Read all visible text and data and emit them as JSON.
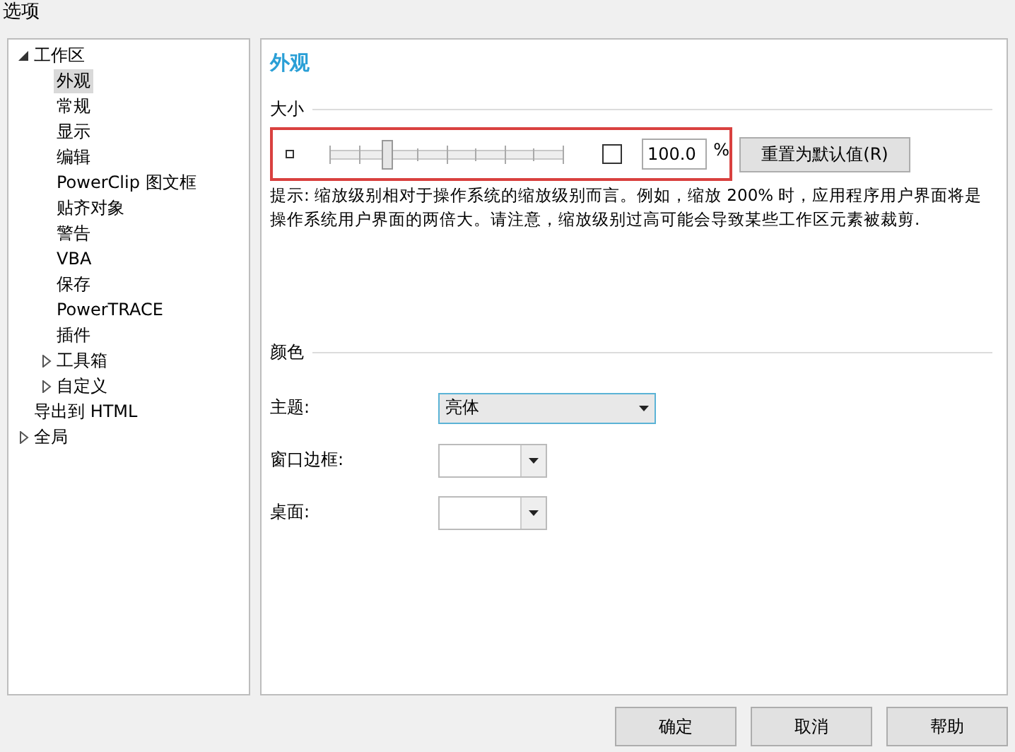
{
  "window": {
    "title": "选项"
  },
  "tree": [
    {
      "label": "工作区",
      "expanded": true,
      "selected": false,
      "children": [
        {
          "label": "外观",
          "selected": true
        },
        {
          "label": "常规",
          "selected": false
        },
        {
          "label": "显示",
          "selected": false
        },
        {
          "label": "编辑",
          "selected": false
        },
        {
          "label": "PowerClip 图文框",
          "selected": false
        },
        {
          "label": "贴齐对象",
          "selected": false
        },
        {
          "label": "警告",
          "selected": false
        },
        {
          "label": "VBA",
          "selected": false
        },
        {
          "label": "保存",
          "selected": false
        },
        {
          "label": "PowerTRACE",
          "selected": false
        },
        {
          "label": "插件",
          "selected": false
        },
        {
          "label": "工具箱",
          "expanded": false,
          "selected": false
        },
        {
          "label": "自定义",
          "expanded": false,
          "selected": false
        }
      ]
    },
    {
      "label": "导出到 HTML",
      "selected": false
    },
    {
      "label": "全局",
      "expanded": false,
      "selected": false
    }
  ],
  "page": {
    "title": "外观",
    "size_section": {
      "heading": "大小",
      "slider": {
        "level": 0.24
      },
      "checkbox": {
        "checked": false
      },
      "zoom_field": {
        "value": "100.0",
        "unit": "%"
      },
      "reset_button": "重置为默认值(R)",
      "hint": "提示: 缩放级别相对于操作系统的缩放级别而言。例如，缩放 200% 时，应用程序用户界面将是操作系统用户界面的两倍大。请注意，缩放级别过高可能会导致某些工作区元素被裁剪."
    },
    "color_section": {
      "heading": "颜色",
      "rows": [
        {
          "label": "主题:",
          "kind": "select",
          "value": "亮体"
        },
        {
          "label": "窗口边框:",
          "kind": "color"
        },
        {
          "label": "桌面:",
          "kind": "color"
        }
      ]
    }
  },
  "buttons": [
    "确定",
    "取消",
    "帮助"
  ]
}
